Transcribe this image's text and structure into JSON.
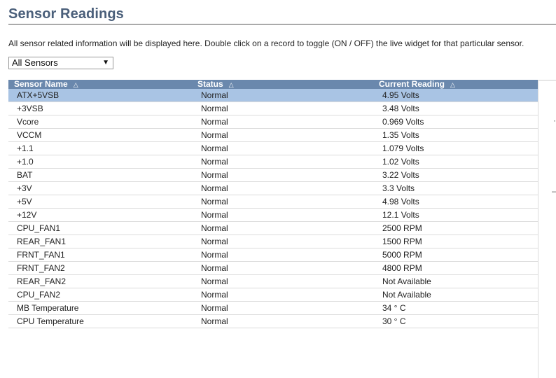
{
  "page": {
    "title": "Sensor Readings",
    "description": "All sensor related information will be displayed here. Double click on a record to toggle (ON / OFF) the live widget for that particular sensor."
  },
  "filter": {
    "selected": "All Sensors"
  },
  "table": {
    "columns": [
      "Sensor Name",
      "Status",
      "Current Reading"
    ],
    "rows": [
      {
        "name": "ATX+5VSB",
        "status": "Normal",
        "reading": "4.95 Volts",
        "selected": true
      },
      {
        "name": "+3VSB",
        "status": "Normal",
        "reading": "3.48 Volts"
      },
      {
        "name": "Vcore",
        "status": "Normal",
        "reading": "0.969 Volts"
      },
      {
        "name": "VCCM",
        "status": "Normal",
        "reading": "1.35 Volts"
      },
      {
        "name": "+1.1",
        "status": "Normal",
        "reading": "1.079 Volts"
      },
      {
        "name": "+1.0",
        "status": "Normal",
        "reading": "1.02 Volts"
      },
      {
        "name": "BAT",
        "status": "Normal",
        "reading": "3.22 Volts"
      },
      {
        "name": "+3V",
        "status": "Normal",
        "reading": "3.3 Volts"
      },
      {
        "name": "+5V",
        "status": "Normal",
        "reading": "4.98 Volts"
      },
      {
        "name": "+12V",
        "status": "Normal",
        "reading": "12.1 Volts"
      },
      {
        "name": "CPU_FAN1",
        "status": "Normal",
        "reading": "2500 RPM"
      },
      {
        "name": "REAR_FAN1",
        "status": "Normal",
        "reading": "1500 RPM"
      },
      {
        "name": "FRNT_FAN1",
        "status": "Normal",
        "reading": "5000 RPM"
      },
      {
        "name": "FRNT_FAN2",
        "status": "Normal",
        "reading": "4800 RPM"
      },
      {
        "name": "REAR_FAN2",
        "status": "Normal",
        "reading": "Not Available"
      },
      {
        "name": "CPU_FAN2",
        "status": "Normal",
        "reading": "Not Available"
      },
      {
        "name": "MB Temperature",
        "status": "Normal",
        "reading": "34 ° C"
      },
      {
        "name": "CPU Temperature",
        "status": "Normal",
        "reading": "30 ° C"
      }
    ]
  },
  "colors": {
    "header_bg": "#6a88ad",
    "selected_row_bg": "#a9c4e4",
    "title": "#4a5f7a"
  }
}
